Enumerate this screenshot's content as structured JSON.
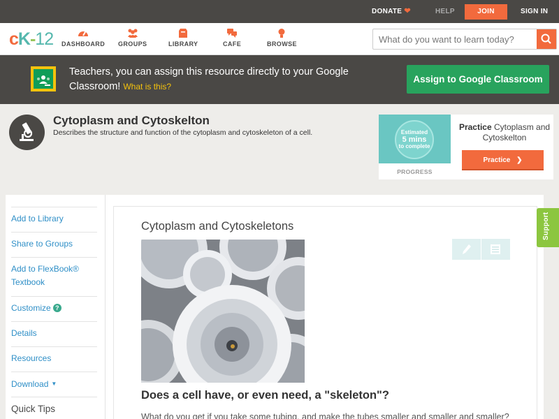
{
  "topbar": {
    "donate": "DONATE",
    "help": "HELP",
    "join": "JOIN",
    "signin": "SIGN IN"
  },
  "nav": {
    "logo": {
      "c": "c",
      "k": "K",
      "dash": "-",
      "num": "12"
    },
    "items": [
      {
        "label": "DASHBOARD",
        "icon": "dashboard-icon"
      },
      {
        "label": "GROUPS",
        "icon": "groups-icon"
      },
      {
        "label": "LIBRARY",
        "icon": "library-icon"
      },
      {
        "label": "CAFE",
        "icon": "cafe-icon"
      },
      {
        "label": "BROWSE",
        "icon": "browse-icon"
      }
    ],
    "search_placeholder": "What do you want to learn today?"
  },
  "banner": {
    "text": "Teachers, you can assign this resource directly to your Google Classroom!",
    "what_link": "What is this?",
    "assign_button": "Assign to Google Classroom"
  },
  "header": {
    "title": "Cytoplasm and Cytoskelton",
    "description": "Describes the structure and function of the cytoplasm and cytoskeleton of a cell."
  },
  "practice": {
    "estimated": "Estimated",
    "time": "5 mins",
    "to_complete": "to complete",
    "progress_label": "PROGRESS",
    "title_bold": "Practice",
    "title_rest": "Cytoplasm and Cytoskelton",
    "button": "Practice"
  },
  "sidebar": {
    "items": [
      {
        "label": "Add to Library"
      },
      {
        "label": "Share to Groups"
      },
      {
        "label": "Add to FlexBook® Textbook"
      },
      {
        "label": "Customize"
      },
      {
        "label": "Details"
      },
      {
        "label": "Resources"
      },
      {
        "label": "Download"
      }
    ],
    "quick_tips": "Quick Tips"
  },
  "content": {
    "title": "Cytoplasm and Cytoskeletons",
    "question": "Does a cell have, or even need, a \"skeleton\"?",
    "paragraph": "What do you get if you take some tubing, and make the tubes smaller and smaller and smaller?"
  },
  "support": "Support",
  "colors": {
    "accent": "#f26a3d",
    "dark": "#4a4845",
    "google_green": "#28a35d",
    "link": "#2f8fc7",
    "support": "#8cc63f",
    "teal": "#6ac6c2"
  }
}
